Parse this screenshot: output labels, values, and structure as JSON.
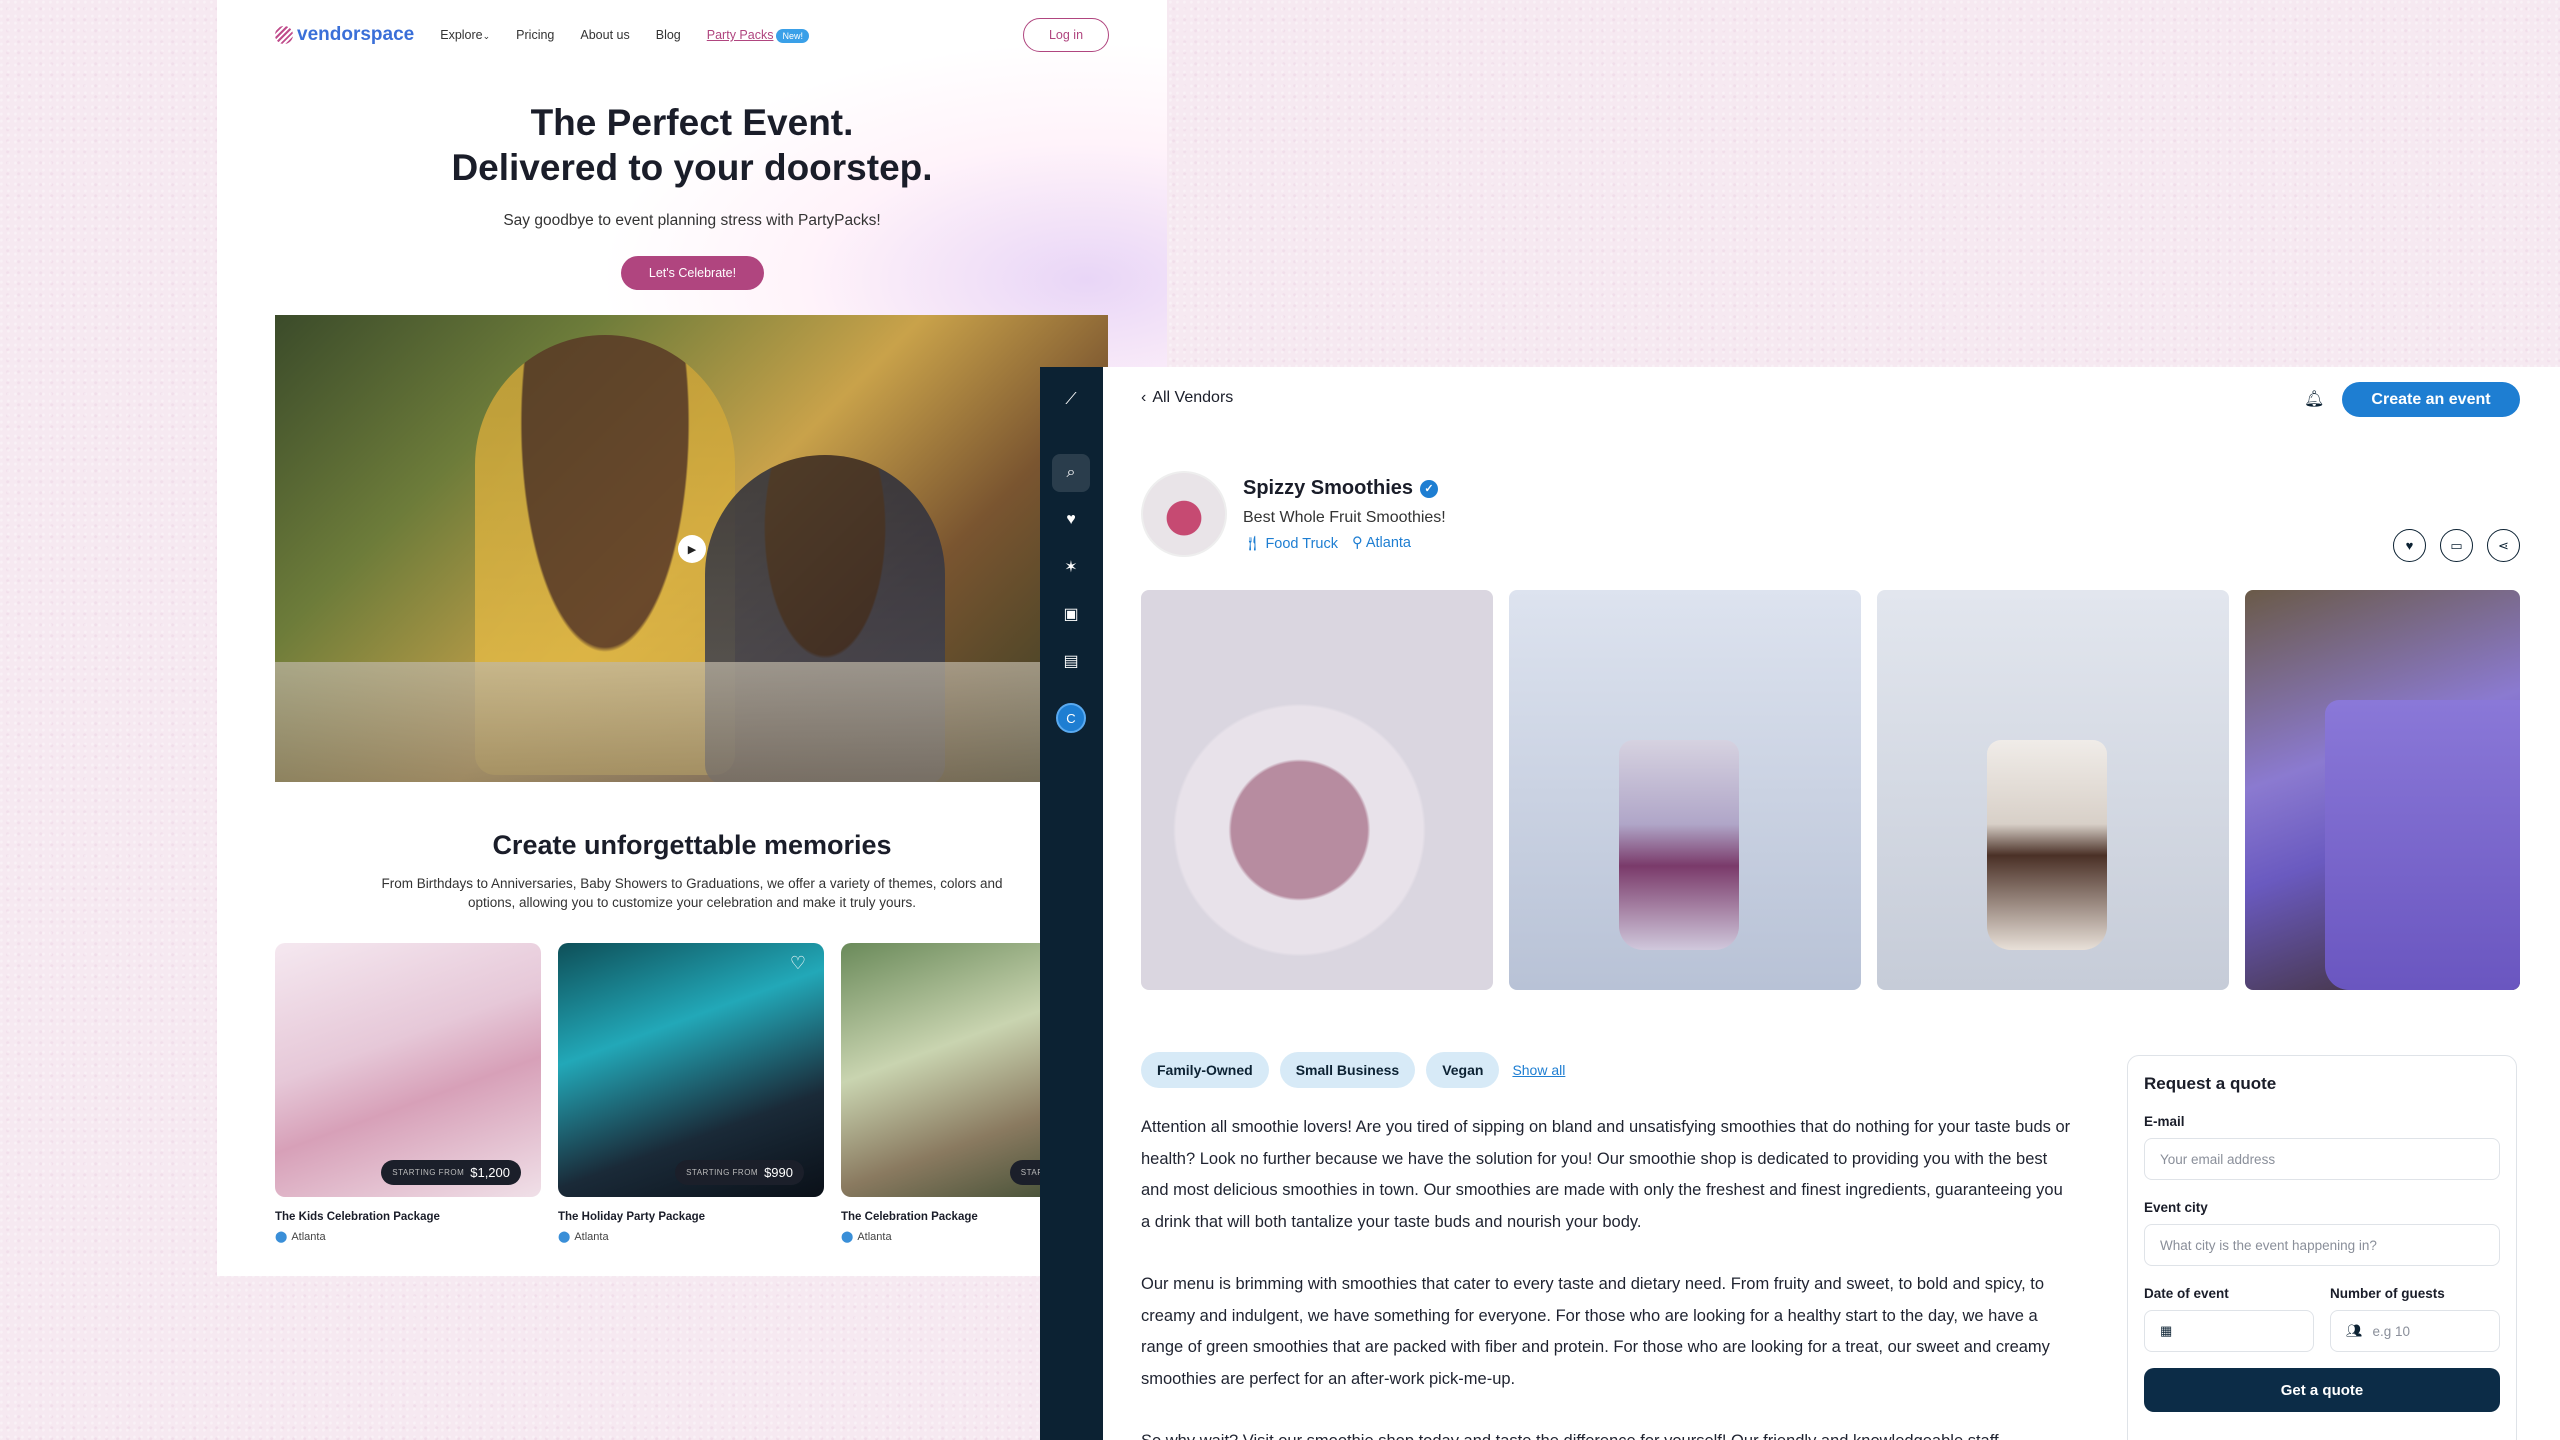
{
  "landing": {
    "logo_text": "vendorspace",
    "nav": [
      {
        "label": "Explore",
        "chevron": "⌄"
      },
      {
        "label": "Pricing"
      },
      {
        "label": "About us"
      },
      {
        "label": "Blog"
      },
      {
        "label": "Party Packs",
        "badge": "New!"
      }
    ],
    "login_label": "Log in",
    "hero_line1": "The Perfect Event.",
    "hero_line2": "Delivered to your doorstep.",
    "hero_sub": "Say goodbye to event planning stress with PartyPacks!",
    "cta_label": "Let's Celebrate!",
    "memories_title": "Create unforgettable memories",
    "memories_sub": "From Birthdays to Anniversaries, Baby Showers to Graduations, we offer a variety of themes, colors and options, allowing you to customize your celebration and make it truly yours.",
    "starting_from": "STARTING FROM",
    "packages": [
      {
        "name": "The Kids Celebration Package",
        "price": "$1,200",
        "location": "Atlanta"
      },
      {
        "name": "The Holiday Party Package",
        "price": "$990",
        "location": "Atlanta"
      },
      {
        "name": "The Celebration Package",
        "price": "$",
        "location": "Atlanta"
      }
    ]
  },
  "app": {
    "back_label": "All Vendors",
    "create_label": "Create an event",
    "avatar_initial": "C",
    "vendor": {
      "name": "Spizzy Smoothies",
      "tagline": "Best Whole Fruit Smoothies!",
      "category": "Food Truck",
      "city": "Atlanta"
    },
    "tags": [
      "Family-Owned",
      "Small Business",
      "Vegan"
    ],
    "show_all": "Show all",
    "description": [
      "Attention all smoothie lovers! Are you tired of sipping on bland and unsatisfying smoothies that do nothing for your taste buds or health? Look no further because we have the solution for you! Our smoothie shop is dedicated to providing you with the best and most delicious smoothies in town. Our smoothies are made with only the freshest and finest ingredients, guaranteeing you a drink that will both tantalize your taste buds and nourish your body.",
      "Our menu is brimming with smoothies that cater to every taste and dietary need. From fruity and sweet, to bold and spicy, to creamy and indulgent, we have something for everyone. For those who are looking for a healthy start to the day, we have a range of green smoothies that are packed with fiber and protein. For those who are looking for a treat, our sweet and creamy smoothies are perfect for an after-work pick-me-up.",
      "So why wait? Visit our smoothie shop today and taste the difference for yourself! Our friendly and knowledgeable staff"
    ],
    "quote": {
      "title": "Request a quote",
      "email_label": "E-mail",
      "email_placeholder": "Your email address",
      "city_label": "Event city",
      "city_placeholder": "What city is the event happening in?",
      "date_label": "Date of event",
      "guests_label": "Number of guests",
      "guests_placeholder": "e.g 10",
      "submit_label": "Get a quote"
    }
  }
}
